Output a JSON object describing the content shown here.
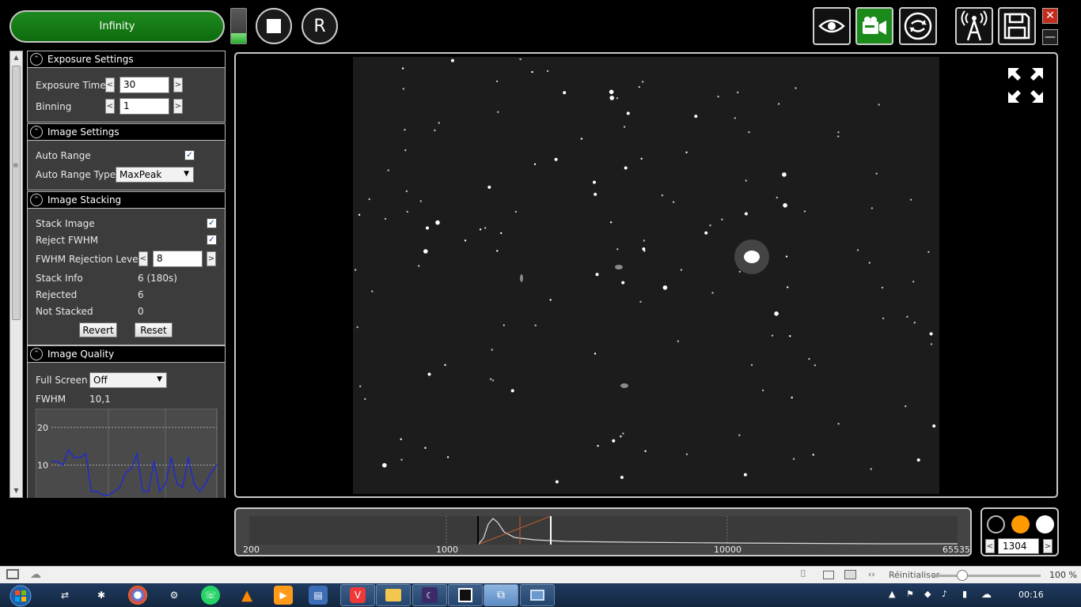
{
  "top": {
    "connect_label": "Infinity",
    "level_fraction": 0.3,
    "stop_button_icon": "stop-square-icon",
    "reset_label": "R",
    "tools": [
      {
        "name": "eye-icon",
        "active": false
      },
      {
        "name": "camera-icon",
        "active": true
      },
      {
        "name": "refresh-loop-icon",
        "active": false
      },
      {
        "name": "antenna-icon",
        "active": false
      },
      {
        "name": "save-disk-icon",
        "active": false
      }
    ],
    "close_glyph": "✕",
    "minimize_glyph": "—"
  },
  "exposure": {
    "title": "Exposure Settings",
    "exposure_time_label": "Exposure Time",
    "exposure_time_value": "30",
    "binning_label": "Binning",
    "binning_value": "1",
    "dec": "<",
    "inc": ">"
  },
  "image_settings": {
    "title": "Image Settings",
    "auto_range_label": "Auto Range",
    "auto_range_checked": true,
    "auto_range_type_label": "Auto Range Type",
    "auto_range_type_value": "MaxPeak"
  },
  "stacking": {
    "title": "Image Stacking",
    "stack_image_label": "Stack Image",
    "stack_image_checked": true,
    "reject_fwhm_label": "Reject FWHM",
    "reject_fwhm_checked": true,
    "fwhm_level_label": "FWHM Rejection Level",
    "fwhm_level_value": "8",
    "stack_info_label": "Stack Info",
    "stack_info_value": "6 (180s)",
    "rejected_label": "Rejected",
    "rejected_value": "6",
    "not_stacked_label": "Not Stacked",
    "not_stacked_value": "0",
    "revert_label": "Revert",
    "reset_label": "Reset"
  },
  "quality": {
    "title": "Image Quality",
    "full_screen_label": "Full Screen",
    "full_screen_value": "Off",
    "fwhm_label": "FWHM",
    "fwhm_value": "10,1",
    "y_tick_20": "20",
    "y_tick_10": "10"
  },
  "chart_data": {
    "type": "line",
    "series": [
      {
        "values": [
          11,
          11,
          10,
          14,
          12,
          12,
          13,
          3,
          3,
          2,
          2,
          3,
          4,
          8,
          9,
          13,
          3,
          3,
          11,
          3,
          5,
          12,
          5,
          4,
          12,
          5,
          3,
          5,
          8,
          10
        ]
      }
    ],
    "ylim": [
      0,
      25
    ],
    "y_ticks": [
      10,
      20
    ],
    "color": "#1e2ad6",
    "grid": true
  },
  "histogram": {
    "ticks": [
      "200",
      "1000",
      "10000",
      "65535"
    ],
    "black_point_value": 1304
  },
  "color_panel": {
    "colors": [
      "#000000",
      "#ff9900",
      "#ffffff"
    ],
    "value": "1304",
    "dec": "<",
    "inc": ">"
  },
  "statusbar": {
    "reset_label": "Réinitialiser",
    "zoom_label": "100 %"
  },
  "taskbar": {
    "time": "00:16"
  }
}
